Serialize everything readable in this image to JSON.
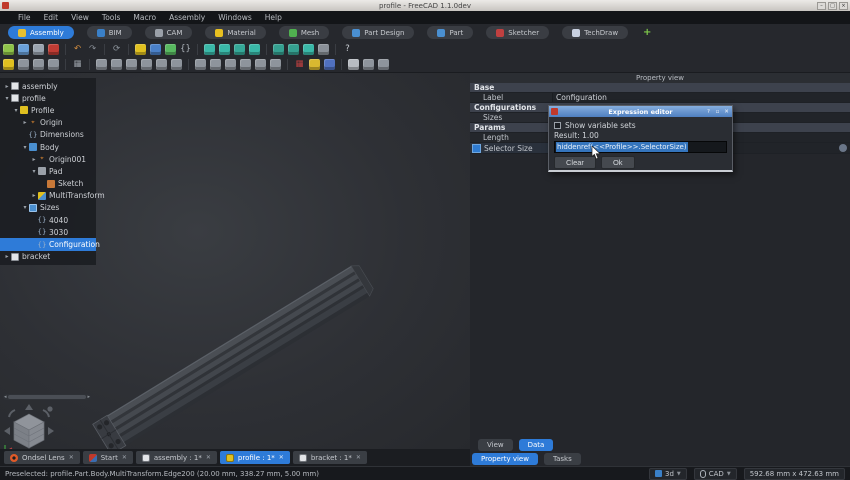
{
  "window": {
    "title": "profile - FreeCAD 1.1.0dev",
    "controls": [
      "–",
      "□",
      "×"
    ]
  },
  "menu": {
    "items": [
      "File",
      "Edit",
      "View",
      "Tools",
      "Macro",
      "Assembly",
      "Windows",
      "Help"
    ]
  },
  "workbenches": {
    "active": "Assembly",
    "add_label": "+",
    "items": [
      {
        "label": "Assembly",
        "color": "#e8c030"
      },
      {
        "label": "BIM",
        "color": "#3a80c8"
      },
      {
        "label": "CAM",
        "color": "#9aa0a8"
      },
      {
        "label": "Material",
        "color": "#e8c020"
      },
      {
        "label": "Mesh",
        "color": "#50b050"
      },
      {
        "label": "Part Design",
        "color": "#4a8fd0"
      },
      {
        "label": "Part",
        "color": "#4a8fd0"
      },
      {
        "label": "Sketcher",
        "color": "#c04040"
      },
      {
        "label": "TechDraw",
        "color": "#c8d0e0"
      }
    ]
  },
  "toolbars": {
    "row2": [
      {
        "n": "new-document",
        "c": "#8fc34a"
      },
      {
        "n": "open-document",
        "c": "#6aa0d8"
      },
      {
        "n": "save-document",
        "c": "#9aa4b0"
      },
      {
        "n": "close-document",
        "c": "#c03c34"
      },
      {
        "sep": true
      },
      {
        "n": "undo",
        "c": "#d89040",
        "g": "↶"
      },
      {
        "n": "redo",
        "c": "#8a9098",
        "g": "↷"
      },
      {
        "sep": true
      },
      {
        "n": "refresh",
        "c": "#9098a0",
        "g": "⟳"
      },
      {
        "sep": true
      },
      {
        "n": "edit-appearance",
        "c": "#e0c020"
      },
      {
        "n": "box-element-selection",
        "c": "#4a80c8"
      },
      {
        "n": "measure",
        "c": "#58b860"
      },
      {
        "n": "expression-editor",
        "c": "#b0b6bd",
        "g": "{}"
      },
      {
        "sep": true
      },
      {
        "n": "create-joint",
        "c": "#3ab8a8"
      },
      {
        "n": "fixed-joint",
        "c": "#3ab8a8"
      },
      {
        "n": "revolute-joint",
        "c": "#35a898"
      },
      {
        "n": "assembly-solve",
        "c": "#3ab8a8"
      },
      {
        "sep": true
      },
      {
        "n": "exploded-view",
        "c": "#35a090"
      },
      {
        "n": "bill-of-materials",
        "c": "#35a090"
      },
      {
        "n": "grounded-joint",
        "c": "#3ab8a8"
      },
      {
        "n": "toggle-grounded",
        "c": "#8a9098"
      },
      {
        "sep": true
      },
      {
        "n": "whats-this",
        "c": "#c8ccd2",
        "g": "?"
      }
    ],
    "row3": [
      {
        "n": "variable-set",
        "c": "#e0c020"
      },
      {
        "n": "insert-part",
        "c": "#8e949c"
      },
      {
        "n": "insert-body",
        "c": "#8e949c"
      },
      {
        "n": "insert-group",
        "c": "#8e949c"
      },
      {
        "sep": true
      },
      {
        "n": "parts-table",
        "c": "#9aa0a8",
        "g": "▦"
      },
      {
        "sep": true
      },
      {
        "n": "solid-box",
        "c": "#8e949c"
      },
      {
        "n": "solid-cylinder",
        "c": "#8e949c"
      },
      {
        "n": "solid-sphere",
        "c": "#8e949c"
      },
      {
        "n": "solid-cone",
        "c": "#8e949c"
      },
      {
        "n": "solid-torus",
        "c": "#8e949c"
      },
      {
        "n": "boolean-union",
        "c": "#8e949c"
      },
      {
        "sep": true
      },
      {
        "n": "mirror",
        "c": "#8e949c"
      },
      {
        "n": "fillet",
        "c": "#8e949c"
      },
      {
        "n": "chamfer",
        "c": "#8e949c"
      },
      {
        "n": "draft",
        "c": "#8e949c"
      },
      {
        "n": "thickness",
        "c": "#8e949c"
      },
      {
        "n": "transform",
        "c": "#8e949c"
      },
      {
        "sep": true
      },
      {
        "n": "spreadsheet",
        "c": "#c04040",
        "g": "▦"
      },
      {
        "n": "filter",
        "c": "#d8b830"
      },
      {
        "n": "defeaturing",
        "c": "#5070c0"
      },
      {
        "sep": true
      },
      {
        "n": "clipboard",
        "c": "#b8bcc2"
      },
      {
        "n": "preferences",
        "c": "#8e949c"
      },
      {
        "n": "grid-toggle",
        "c": "#8e949c"
      }
    ]
  },
  "tree": {
    "items": [
      {
        "label": "assembly"
      },
      {
        "label": "profile"
      },
      {
        "label": "Profile"
      },
      {
        "label": "Origin"
      },
      {
        "label": "Dimensions"
      },
      {
        "label": "Body"
      },
      {
        "label": "Origin001"
      },
      {
        "label": "Pad"
      },
      {
        "label": "Sketch"
      },
      {
        "label": "MultiTransform"
      },
      {
        "label": "Sizes"
      },
      {
        "label": "4040"
      },
      {
        "label": "3030"
      },
      {
        "label": "Configuration"
      },
      {
        "label": "bracket"
      }
    ]
  },
  "property_view": {
    "title": "Property view",
    "groups": [
      {
        "header": "Base",
        "rows": [
          {
            "name": "Label",
            "value": "Configuration"
          }
        ]
      },
      {
        "header": "Configurations",
        "rows": [
          {
            "name": "Sizes",
            "value": ""
          }
        ]
      },
      {
        "header": "Params",
        "rows": [
          {
            "name": "Length",
            "value": ""
          },
          {
            "name": "Selector Size",
            "value": ""
          }
        ]
      }
    ],
    "tabs": {
      "view": "View",
      "data": "Data"
    },
    "dock_tabs": {
      "property_view": "Property view",
      "tasks": "Tasks"
    }
  },
  "expression_dialog": {
    "title": "Expression editor",
    "show_variable_sets_label": "Show variable sets",
    "result": "Result: 1.00",
    "expression": "hiddenref(<<Profile>>.SelectorSize)",
    "clear_label": "Clear",
    "ok_label": "Ok",
    "controls": [
      "?",
      "▫",
      "✕"
    ]
  },
  "mdi_tabs": {
    "close_glyph": "✕",
    "items": [
      {
        "label": "Ondsel Lens"
      },
      {
        "label": "Start"
      },
      {
        "label": "assembly : 1*"
      },
      {
        "label": "profile : 1*"
      },
      {
        "label": "bracket : 1*"
      }
    ]
  },
  "status_bar": {
    "message": "Preselected: profile.Part.Body.MultiTransform.Edge200 (20.00 mm, 338.27 mm, 5.00 mm)",
    "view_mode": "3d",
    "nav_style": "CAD",
    "dimensions": "592.68 mm x 472.63 mm"
  },
  "colors": {
    "accent": "#2e7bd8",
    "selection": "#3575bd",
    "dialog_title": "#5b8cc8"
  }
}
